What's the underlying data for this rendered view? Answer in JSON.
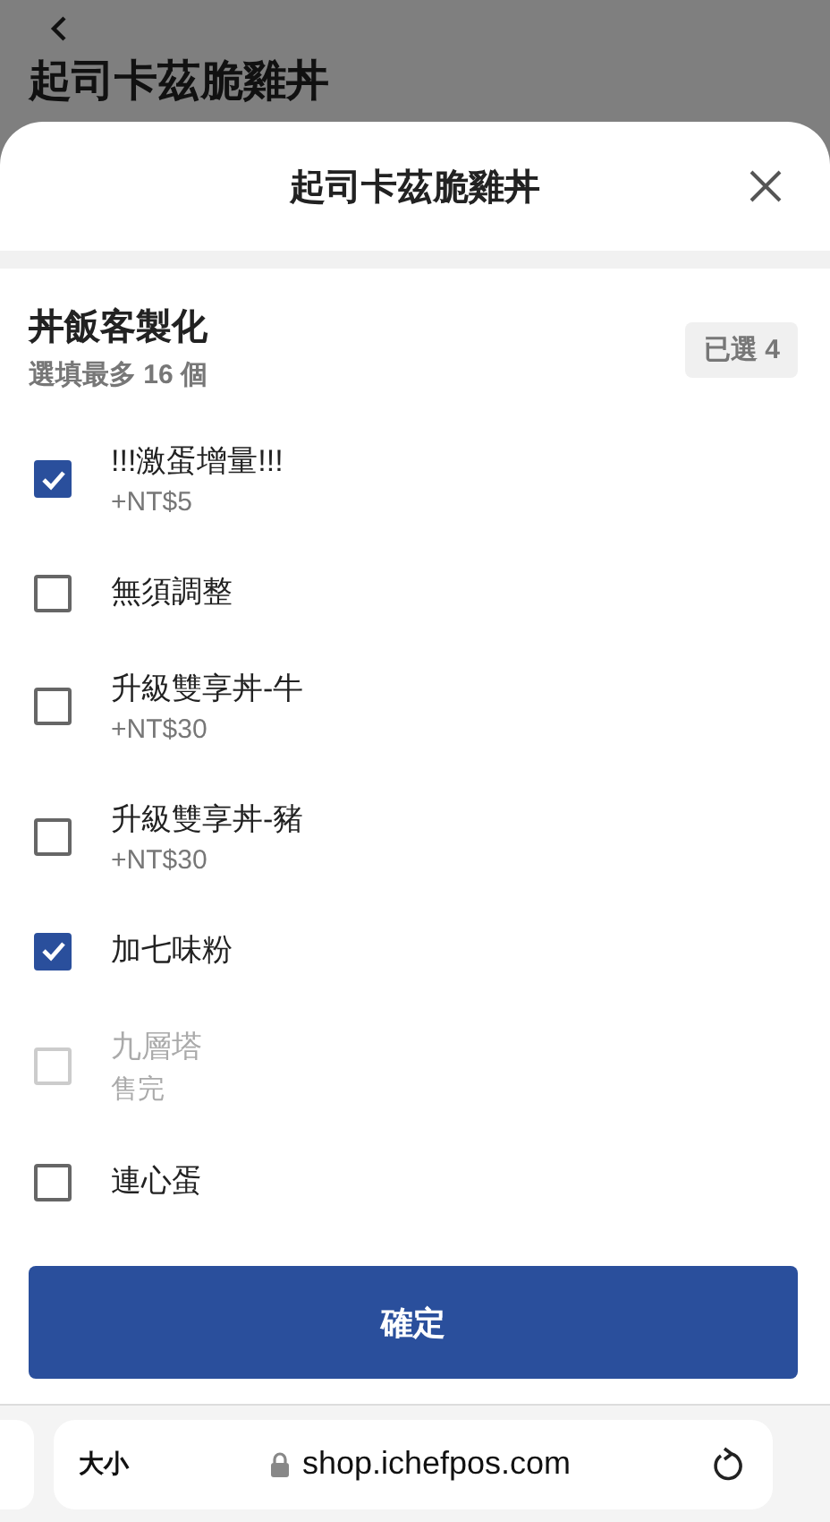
{
  "background_page": {
    "title": "起司卡茲脆雞丼"
  },
  "sheet": {
    "title": "起司卡茲脆雞丼"
  },
  "section": {
    "title": "丼飯客製化",
    "subtitle": "選填最多 16 個",
    "badge": "已選 4"
  },
  "options": [
    {
      "name": "!!!激蛋增量!!!",
      "price": "+NT$5",
      "checked": true,
      "disabled": false
    },
    {
      "name": "無須調整",
      "checked": false,
      "disabled": false
    },
    {
      "name": "升級雙享丼-牛",
      "price": "+NT$30",
      "checked": false,
      "disabled": false
    },
    {
      "name": "升級雙享丼-豬",
      "price": "+NT$30",
      "checked": false,
      "disabled": false
    },
    {
      "name": "加七味粉",
      "checked": true,
      "disabled": false
    },
    {
      "name": "九層塔",
      "price": "售完",
      "checked": false,
      "disabled": true
    },
    {
      "name": "連心蛋",
      "checked": false,
      "disabled": false
    }
  ],
  "confirm_button": "確定",
  "browser": {
    "text_size": "大小",
    "url": "shop.ichefpos.com"
  }
}
